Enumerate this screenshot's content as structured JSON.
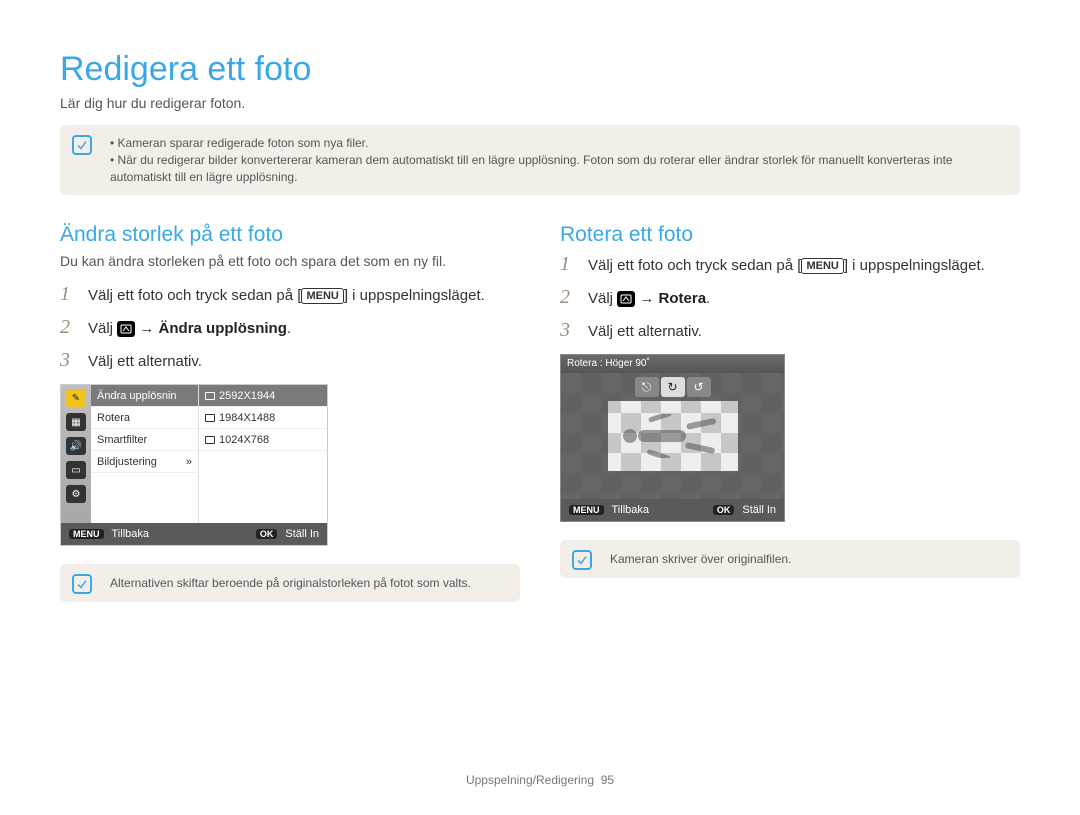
{
  "title": "Redigera ett foto",
  "subtitle": "Lär dig hur du redigerar foton.",
  "info_bullets": [
    "Kameran sparar redigerade foton som nya filer.",
    "När du redigerar bilder konvertererar kameran dem automatiskt till en lägre upplösning. Foton som du roterar eller ändrar storlek för manuellt konverteras inte automatiskt till en lägre upplösning."
  ],
  "left": {
    "heading": "Ändra storlek på ett foto",
    "subheading": "Du kan ändra storleken på ett foto och spara det som en ny fil.",
    "steps": {
      "s1_pre": "Välj ett foto och tryck sedan på [",
      "s1_menu": "MENU",
      "s1_post": "] i uppspelningsläget.",
      "s2_pre": "Välj ",
      "s2_arrow": " → ",
      "s2_bold": "Ändra upplösning",
      "s2_post": ".",
      "s3": "Välj ett alternativ."
    },
    "screen": {
      "menu_left": [
        "Ändra upplösnin",
        "Rotera",
        "Smartfilter",
        "Bildjustering"
      ],
      "menu_right": [
        "2592X1944",
        "1984X1488",
        "1024X768"
      ],
      "more": "»",
      "footer_back_btn": "MENU",
      "footer_back": "Tillbaka",
      "footer_ok_btn": "OK",
      "footer_set": "Ställ In"
    },
    "note": "Alternativen skiftar beroende på originalstorleken på fotot som valts."
  },
  "right": {
    "heading": "Rotera ett foto",
    "steps": {
      "s1_pre": "Välj ett foto och tryck sedan på [",
      "s1_menu": "MENU",
      "s1_post": "] i uppspelningsläget.",
      "s2_pre": "Välj ",
      "s2_arrow": " → ",
      "s2_bold": "Rotera",
      "s2_post": ".",
      "s3": "Välj ett alternativ."
    },
    "screen": {
      "header": "Rotera : Höger 90˚",
      "footer_back_btn": "MENU",
      "footer_back": "Tillbaka",
      "footer_ok_btn": "OK",
      "footer_set": "Ställ In"
    },
    "note": "Kameran skriver över originalfilen."
  },
  "page_footer": {
    "section": "Uppspelning/Redigering",
    "page": "95"
  }
}
